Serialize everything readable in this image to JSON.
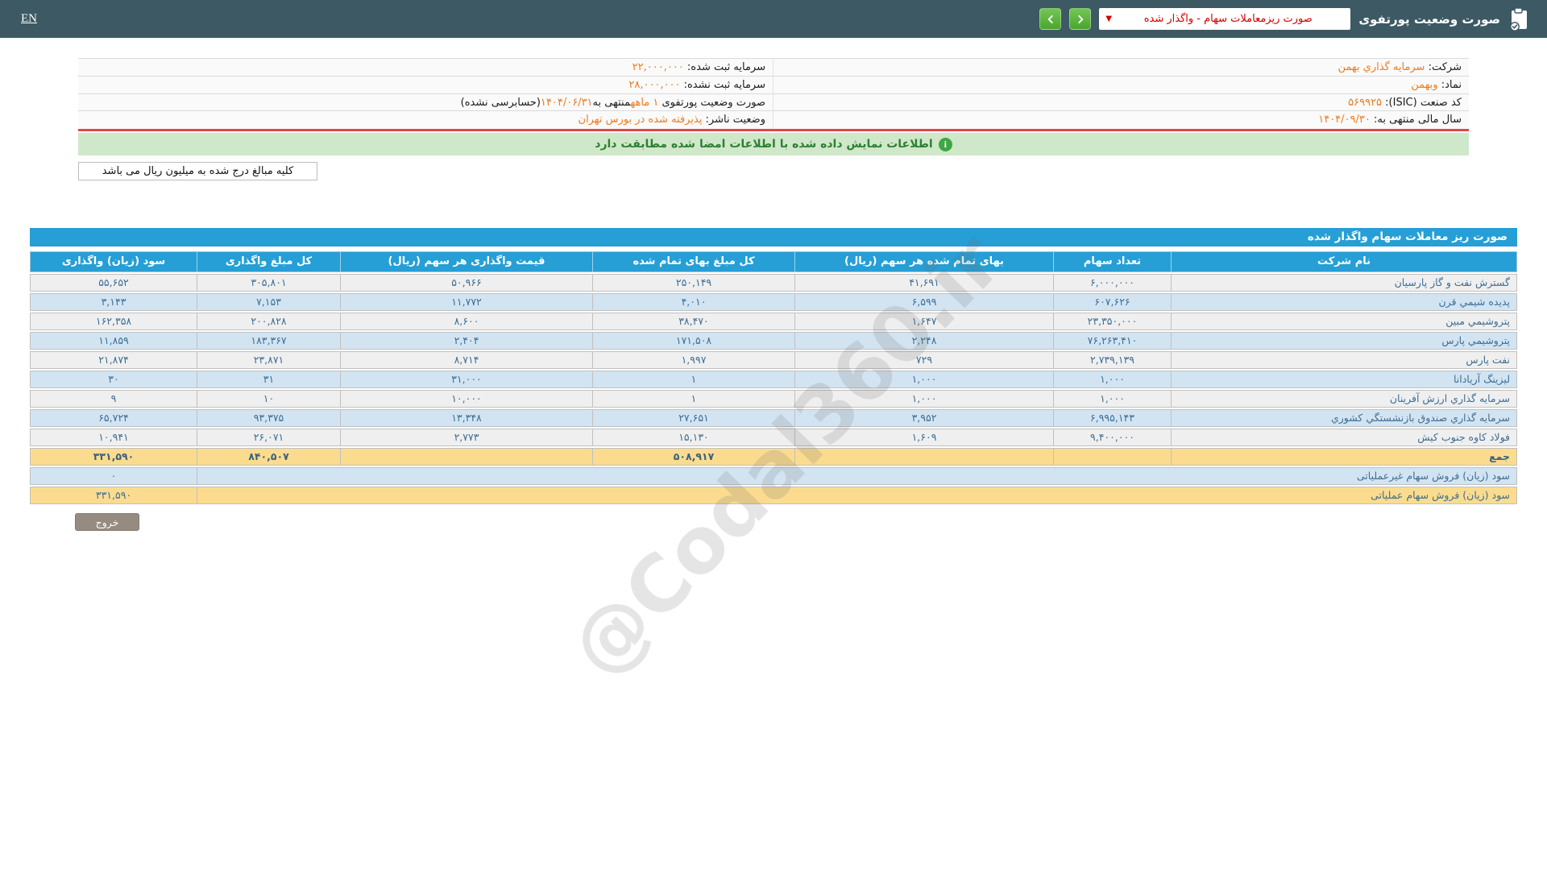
{
  "topbar": {
    "en": "EN",
    "title": "صورت وضعیت پورتفوی",
    "dropdown_value": "صورت ریزمعاملات سهام - واگذار شده"
  },
  "info": {
    "right_rows": [
      [
        {
          "t": "شرکت:  ",
          "o": false
        },
        {
          "t": "سرمایه گذاري بهمن",
          "o": true
        }
      ],
      [
        {
          "t": "نماد:  ",
          "o": false
        },
        {
          "t": "وبهمن",
          "o": true
        }
      ],
      [
        {
          "t": "کد صنعت (ISIC):  ",
          "o": false
        },
        {
          "t": "۵۶۹۹۲۵",
          "o": true
        }
      ],
      [
        {
          "t": "سال مالی منتهی به:  ",
          "o": false
        },
        {
          "t": "۱۴۰۴/۰۹/۳۰",
          "o": true
        }
      ]
    ],
    "left_rows": [
      [
        {
          "t": "سرمایه ثبت شده:  ",
          "o": false
        },
        {
          "t": "۲۲,۰۰۰,۰۰۰",
          "o": true
        }
      ],
      [
        {
          "t": "سرمایه ثبت نشده:  ",
          "o": false
        },
        {
          "t": "۲۸,۰۰۰,۰۰۰",
          "o": true
        }
      ],
      [
        {
          "t": "صورت وضعیت پورتفوی ",
          "o": false
        },
        {
          "t": "۱ ماهه",
          "o": true
        },
        {
          "t": "منتهی به",
          "o": false
        },
        {
          "t": "۱۴۰۴/۰۶/۳۱",
          "o": true
        },
        {
          "t": "(حسابرسی نشده)",
          "o": false
        }
      ],
      [
        {
          "t": "وضعیت ناشر:  ",
          "o": false
        },
        {
          "t": "پذیرفته شده در بورس تهران",
          "o": true
        }
      ]
    ]
  },
  "message_bar": {
    "text": "اطلاعات نمایش داده شده با اطلاعات امضا شده مطابقت دارد",
    "icon": "info-icon"
  },
  "note": "کلیه مبالغ درج شده به میلیون ریال می باشد",
  "table": {
    "title": "صورت ریز معاملات سهام واگذار شده",
    "columns": [
      "نام شرکت",
      "تعداد سهام",
      "بهای تمام شده هر سهم (ریال)",
      "کل مبلغ بهای تمام شده",
      "قیمت واگذاری هر سهم (ریال)",
      "کل مبلغ واگذاری",
      "سود (زیان) واگذاری"
    ],
    "rows": [
      [
        "گسترش نفت و گاز پارسیان",
        "۶,۰۰۰,۰۰۰",
        "۴۱,۶۹۱",
        "۲۵۰,۱۴۹",
        "۵۰,۹۶۶",
        "۳۰۵,۸۰۱",
        "۵۵,۶۵۲"
      ],
      [
        "پدیده شیمي قرن",
        "۶۰۷,۶۲۶",
        "۶,۵۹۹",
        "۴,۰۱۰",
        "۱۱,۷۷۲",
        "۷,۱۵۳",
        "۳,۱۴۳"
      ],
      [
        "پتروشیمي مبین",
        "۲۳,۳۵۰,۰۰۰",
        "۱,۶۴۷",
        "۳۸,۴۷۰",
        "۸,۶۰۰",
        "۲۰۰,۸۲۸",
        "۱۶۲,۳۵۸"
      ],
      [
        "پتروشیمي پارس",
        "۷۶,۲۶۳,۴۱۰",
        "۲,۲۴۸",
        "۱۷۱,۵۰۸",
        "۲,۴۰۴",
        "۱۸۳,۳۶۷",
        "۱۱,۸۵۹"
      ],
      [
        "نفت پارس",
        "۲,۷۳۹,۱۳۹",
        "۷۲۹",
        "۱,۹۹۷",
        "۸,۷۱۴",
        "۲۳,۸۷۱",
        "۲۱,۸۷۴"
      ],
      [
        "لیزینگ آریادانا",
        "۱,۰۰۰",
        "۱,۰۰۰",
        "۱",
        "۳۱,۰۰۰",
        "۳۱",
        "۳۰"
      ],
      [
        "سرمایه گذاري ارزش آفرینان",
        "۱,۰۰۰",
        "۱,۰۰۰",
        "۱",
        "۱۰,۰۰۰",
        "۱۰",
        "۹"
      ],
      [
        "سرمایه گذاري صندوق بازنشستگي کشوري",
        "۶,۹۹۵,۱۴۳",
        "۳,۹۵۲",
        "۲۷,۶۵۱",
        "۱۳,۳۴۸",
        "۹۳,۳۷۵",
        "۶۵,۷۲۴"
      ],
      [
        "فولاد کاوه جنوب کیش",
        "۹,۴۰۰,۰۰۰",
        "۱,۶۰۹",
        "۱۵,۱۳۰",
        "۲,۷۷۳",
        "۲۶,۰۷۱",
        "۱۰,۹۴۱"
      ]
    ],
    "total_row": [
      "جمع",
      "",
      "",
      "۵۰۸,۹۱۷",
      "",
      "۸۴۰,۵۰۷",
      "۳۳۱,۵۹۰"
    ],
    "extra_rows": [
      {
        "label": "سود (زیان) فروش سهام غیرعملیاتی",
        "value": "۰",
        "variant": "blue"
      },
      {
        "label": "سود (زیان) فروش سهام عملیاتی",
        "value": "۳۳۱,۵۹۰",
        "variant": "yellow"
      }
    ]
  },
  "exit_button": "خروج",
  "watermark": "@Codal360.ir",
  "colors": {
    "topbar_bg": "#3d5964",
    "accent_blue": "#259fd6",
    "value_orange": "#ee7c1f",
    "dropdown_red": "#d40000",
    "banner_green_bg": "#cfe8c9",
    "banner_green_text": "#2e8033",
    "row_gray": "#efefef",
    "row_blue": "#d2e4f2",
    "row_yellow": "#fbdc8e",
    "divider_red": "#e04848",
    "nav_button_green": "#4aa52e",
    "exit_gray": "#968b80"
  }
}
